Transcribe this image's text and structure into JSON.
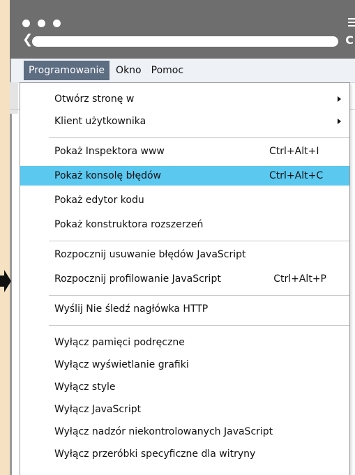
{
  "window": {
    "back_glyph": "❮",
    "reload_glyph": "C"
  },
  "menubar": {
    "items": [
      {
        "label": "Programowanie",
        "active": true
      },
      {
        "label": "Okno",
        "active": false
      },
      {
        "label": "Pomoc",
        "active": false
      }
    ]
  },
  "dropdown": {
    "items": [
      {
        "label": "Otwórz stronę w",
        "shortcut": "",
        "submenu": true
      },
      {
        "label": "Klient użytkownika",
        "shortcut": "",
        "submenu": true
      },
      {
        "label": "Pokaż Inspektora www",
        "shortcut": "Ctrl+Alt+I"
      },
      {
        "label": "Pokaż konsolę błędów",
        "shortcut": "Ctrl+Alt+C",
        "highlighted": true
      },
      {
        "label": "Pokaż edytor kodu",
        "shortcut": ""
      },
      {
        "label": "Pokaż konstruktora rozszerzeń",
        "shortcut": ""
      },
      {
        "label": "Rozpocznij usuwanie błędów JavaScript",
        "shortcut": ""
      },
      {
        "label": "Rozpocznij profilowanie JavaScript",
        "shortcut": "Ctrl+Alt+P"
      },
      {
        "label": "Wyślij Nie śledź nagłówka HTTP",
        "shortcut": ""
      },
      {
        "label": "Wyłącz pamięci podręczne",
        "shortcut": ""
      },
      {
        "label": "Wyłącz wyświetlanie grafiki",
        "shortcut": ""
      },
      {
        "label": "Wyłącz style",
        "shortcut": ""
      },
      {
        "label": "Wyłącz JavaScript",
        "shortcut": ""
      },
      {
        "label": "Wyłącz nadzór niekontrolowanych JavaScript",
        "shortcut": ""
      },
      {
        "label": "Wyłącz przeróbki specyficzne dla witryny",
        "shortcut": ""
      }
    ]
  },
  "colors": {
    "page_background": "#f6e2c3",
    "chrome": "#6e6e6e",
    "menubar_active": "#5d6d82",
    "highlight": "#5bc8f0"
  }
}
